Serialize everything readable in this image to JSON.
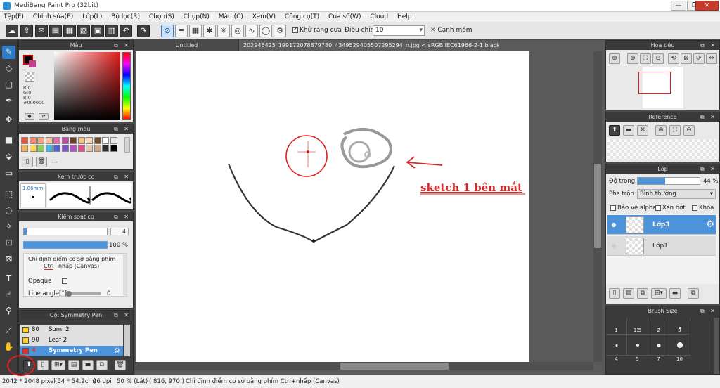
{
  "window": {
    "title": "MediBang Paint Pro (32bit)",
    "min": "—",
    "max": "❐",
    "close": "✕"
  },
  "menu": [
    "Tệp(F)",
    "Chỉnh sửa(E)",
    "Lớp(L)",
    "Bộ lọc(R)",
    "Chọn(S)",
    "Chụp(N)",
    "Màu (C)",
    "Xem(V)",
    "Công cụ(T)",
    "Cửa sổ(W)",
    "Cloud",
    "Help"
  ],
  "toolbar": {
    "antialias_label": "Khử răng cưa",
    "adjust_label": "Điều chỉnh",
    "adjust_value": "10",
    "sharp_edge_label": "Cạnh mềm"
  },
  "color_panel": {
    "title": "Màu",
    "r": "R:0",
    "g": "G:0",
    "b": "B:0",
    "hex": "#000000"
  },
  "palette_panel": {
    "title": "Bảng màu",
    "swatches": [
      "#e05a3c",
      "#f28a6b",
      "#f4a77c",
      "#f5c59c",
      "#e86aa6",
      "#c04ea0",
      "#6b3f2a",
      "#f2c38a",
      "#f7d9b8",
      "#6e4f2f",
      "#ffffff",
      "#e8e8e8",
      "#f0b35a",
      "#ffd94a",
      "#8bd05a",
      "#3fb8e8",
      "#4b62d8",
      "#7a4fd0",
      "#b24fc4",
      "#e34e8a",
      "#e6c9b0",
      "#cfa98a",
      "#2d2d2d",
      "#000000"
    ],
    "ellipsis": "---"
  },
  "preview_panel": {
    "title": "Xem trước cọ",
    "size": "1.06mm"
  },
  "brush_control": {
    "title": "Kiểm soát cọ",
    "size": "4",
    "opacity": "100 %",
    "hint_line1": "Chỉ định điểm cơ sở bằng phím",
    "hint_ctrl": "Ctrl",
    "hint_rest": "+nhấp (Canvas)",
    "opaque_label": "Opaque",
    "angle_label": "Line angle[°]",
    "angle_value": "0"
  },
  "brush_list": {
    "title": "Cọ: Symmetry Pen",
    "items": [
      {
        "size": "80",
        "name": "Sumi 2",
        "color": "#ffd11a"
      },
      {
        "size": "90",
        "name": "Leaf 2",
        "color": "#ffd11a"
      },
      {
        "size": "4",
        "name": "Symmetry Pen",
        "color": "#e03030",
        "selected": true
      }
    ]
  },
  "tabs": {
    "untitled": "Untitled",
    "file": "202946425_199172078879780_4349529405507295294_n.jpg < sRGB IEC61966-2-1 black scaled >"
  },
  "annotation": {
    "text": "sketch 1 bên mắt",
    "color": "#d42a2a"
  },
  "navigator": {
    "title": "Hoa tiêu"
  },
  "reference": {
    "title": "Reference"
  },
  "layers": {
    "title": "Lớp",
    "opacity_label": "Độ trong",
    "opacity_value": "44 %",
    "opacity": 0.44,
    "blend_label": "Pha trộn",
    "blend_value": "Bình thường",
    "protect_alpha": "Bảo vệ alpha",
    "clipping": "Xén bớt",
    "lock": "Khóa",
    "items": [
      {
        "name": "Lớp3",
        "selected": true
      },
      {
        "name": "Lớp1",
        "selected": false
      }
    ]
  },
  "brush_size": {
    "title": "Brush Size",
    "sizes": [
      "1",
      "1.5",
      "2",
      "3",
      "4",
      "5",
      "7",
      "10"
    ]
  },
  "status": {
    "dims": "2042 * 2048 pixel",
    "cm": "(54 * 54.2cm)",
    "dpi": "96 dpi",
    "zoom": "50 % (Lật)",
    "coords": "( 816, 970 )",
    "hint": "Chỉ định điểm cơ sở bằng phím Ctrl+nhấp (Canvas)"
  },
  "colors": {
    "accent": "#2f7cc8",
    "panel_dark": "#3a3a3a",
    "selection_blue": "#4d93d9"
  }
}
